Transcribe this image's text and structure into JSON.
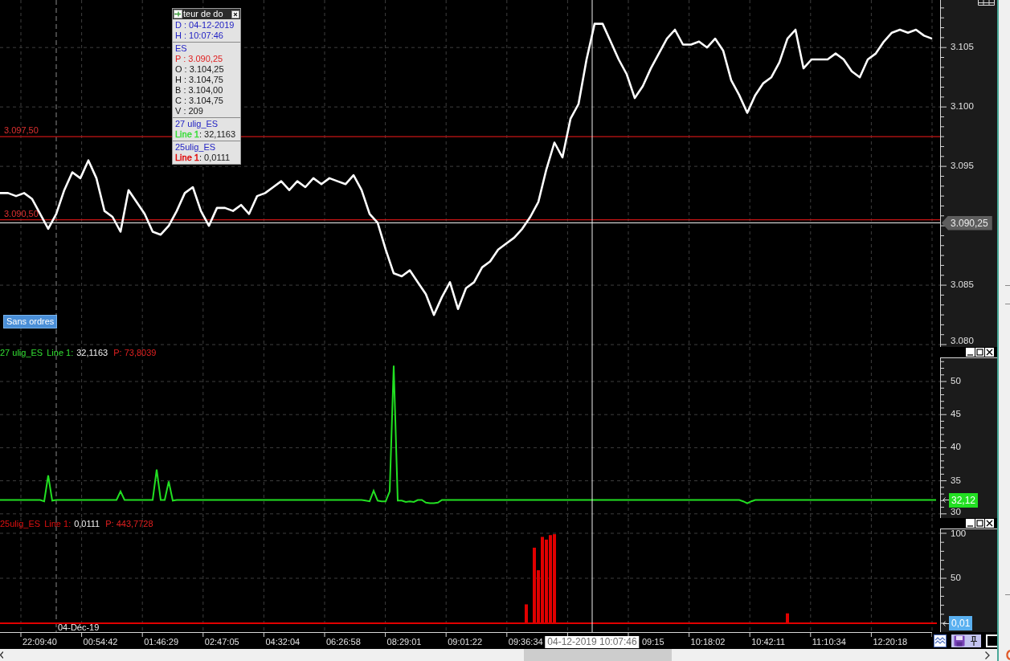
{
  "price_panel": {
    "order_button": {
      "label": "Sans ordres"
    },
    "chart_data": {
      "type": "line",
      "series": [
        {
          "color": "#ffffff",
          "values": [
            3092.75,
            3092.75,
            3092.5,
            3092.75,
            3092.25,
            3091,
            3089.75,
            3091,
            3093,
            3094.5,
            3094,
            3095.5,
            3094,
            3091.25,
            3090.75,
            3089.5,
            3093,
            3092,
            3091,
            3089.5,
            3089.25,
            3090,
            3091.25,
            3092.75,
            3093.25,
            3091.25,
            3090,
            3091.5,
            3091.5,
            3091.25,
            3091.75,
            3091,
            3092.5,
            3092.75,
            3093.25,
            3093.75,
            3093,
            3093.75,
            3093.25,
            3094,
            3093.5,
            3094,
            3093.75,
            3093.5,
            3094.25,
            3093,
            3091,
            3090.25,
            3088,
            3086,
            3085.75,
            3086.25,
            3085.25,
            3084.25,
            3082.5,
            3084,
            3085.25,
            3083,
            3084.75,
            3085.25,
            3086.5,
            3087,
            3088,
            3088.5,
            3089,
            3089.75,
            3090.75,
            3092,
            3094.75,
            3097,
            3095.75,
            3099,
            3100.25,
            3104,
            3107,
            3107,
            3105.5,
            3104,
            3102.75,
            3100.75,
            3101.75,
            3103.25,
            3104.5,
            3105.75,
            3106.5,
            3105.25,
            3105.25,
            3105.5,
            3105,
            3105.75,
            3104.75,
            3102.25,
            3101,
            3099.5,
            3101,
            3102,
            3102.5,
            3103.75,
            3105.75,
            3106.5,
            3103.25,
            3104,
            3104,
            3104,
            3104.5,
            3104,
            3103,
            3102.5,
            3104,
            3104.5,
            3105.5,
            3106.25,
            3106.5,
            3106.25,
            3106.5,
            3106,
            3105.75
          ]
        }
      ],
      "ylim": [
        3079.8,
        3109
      ],
      "yticks": [
        {
          "value": 3080,
          "label": "3.080"
        },
        {
          "value": 3085,
          "label": "3.085"
        },
        {
          "value": 3095,
          "label": "3.095"
        },
        {
          "value": 3100,
          "label": "3.100"
        },
        {
          "value": 3105,
          "label": "3.105"
        }
      ],
      "grid": true,
      "ref_lines": [
        {
          "axis": "y",
          "value": 3097.5,
          "label": "3.097,50"
        },
        {
          "axis": "y",
          "value": 3090.5,
          "label": "3.090,50"
        }
      ]
    }
  },
  "data_window": {
    "title": "teur de do",
    "sections": [
      {
        "lines": [
          {
            "kind": "heading",
            "text": "D : 04-12-2019"
          },
          {
            "kind": "heading",
            "text": "H : 10:07:46"
          }
        ]
      },
      {
        "lines": [
          {
            "kind": "heading",
            "text": "ES"
          },
          {
            "kind": "price",
            "text": "P : 3.090,25"
          },
          {
            "kind": "field",
            "text": "O : 3.104,25"
          },
          {
            "kind": "field",
            "text": "H : 3.104,75"
          },
          {
            "kind": "field",
            "text": "B : 3.104,00"
          },
          {
            "kind": "field",
            "text": "C : 3.104,75"
          },
          {
            "kind": "field",
            "text": "V : 209"
          }
        ]
      },
      {
        "lines": [
          {
            "kind": "heading",
            "text": "27 ulig_ES"
          },
          {
            "kind": "series",
            "label": "Line 1",
            "value": ": 32,1163",
            "color": "#33dd33"
          }
        ]
      },
      {
        "lines": [
          {
            "kind": "heading",
            "text": "25ulig_ES"
          },
          {
            "kind": "series",
            "label": "Line 1",
            "value": ": 0,0111",
            "color": "#e00000"
          }
        ]
      }
    ]
  },
  "indicators": [
    {
      "name": "27 ulig_ES",
      "color": "#33e033",
      "line_label": "Line 1:",
      "line_value": "32,1163",
      "p_value": "P: 73,8039",
      "value_tag": {
        "text": "32,12",
        "color": "#22e022"
      },
      "chart_data": {
        "type": "line",
        "series": [
          {
            "color": "#22e022",
            "values": [
              32.1,
              32.1,
              32.1,
              32.1,
              32.1,
              32.1,
              32.1,
              32.1,
              32.1,
              32.1,
              32.1,
              31.9,
              35.8,
              32.0,
              32.1,
              32.1,
              32.1,
              32.1,
              32.1,
              32.1,
              32.1,
              32.1,
              32.1,
              32.1,
              32.1,
              32.1,
              32.1,
              32.1,
              32.1,
              32.1,
              33.4,
              32.1,
              32.1,
              32.1,
              32.1,
              32.1,
              32.1,
              32.1,
              32.1,
              36.7,
              32.1,
              32.1,
              34.9,
              32.0,
              32.1,
              32.1,
              32.1,
              32.1,
              32.1,
              32.1,
              32.1,
              32.1,
              32.1,
              32.1,
              32.1,
              32.1,
              32.1,
              32.1,
              32.1,
              32.1,
              32.1,
              32.1,
              32.1,
              32.1,
              32.1,
              32.1,
              32.1,
              32.1,
              32.1,
              32.1,
              32.1,
              32.1,
              32.1,
              32.1,
              32.1,
              32.1,
              32.1,
              32.1,
              32.1,
              32.1,
              32.1,
              32.1,
              32.1,
              32.1,
              32.1,
              32.1,
              32.1,
              32.1,
              32.1,
              32.1,
              32.1,
              32.0,
              31.9,
              33.5,
              32.0,
              31.9,
              31.9,
              33.4,
              52.4,
              32.0,
              32.0,
              31.8,
              31.9,
              31.8,
              32.1,
              32.1,
              31.7,
              31.6,
              31.6,
              31.7,
              32.1,
              32.1,
              32.1,
              32.1,
              32.1,
              32.1,
              32.1,
              32.1,
              32.1,
              32.1,
              32.1,
              32.1,
              32.1,
              32.1,
              32.1,
              32.1,
              32.1,
              32.1,
              32.1,
              32.1,
              32.1,
              32.1,
              32.1,
              32.1,
              32.1,
              32.1,
              32.1,
              32.1,
              32.1,
              32.1,
              32.1,
              32.1,
              32.1,
              32.1,
              32.1,
              32.1,
              32.1,
              32.1,
              32.1,
              32.1,
              32.1,
              32.1,
              32.1,
              32.1,
              32.1,
              32.1,
              32.1,
              32.1,
              32.1,
              32.1,
              32.1,
              32.1,
              32.1,
              32.1,
              32.1,
              32.1,
              32.1,
              32.1,
              32.1,
              32.1,
              32.1,
              32.1,
              32.1,
              32.1,
              32.1,
              32.1,
              32.1,
              32.1,
              32.1,
              32.1,
              32.1,
              32.1,
              32.1,
              32.1,
              32.1,
              31.9,
              31.6,
              31.9,
              32.1,
              32.1,
              32.1,
              32.1,
              32.1,
              32.1,
              32.1,
              32.1,
              32.1,
              32.1,
              32.1,
              32.1,
              32.1,
              32.1,
              32.1,
              32.1,
              32.1,
              32.1,
              32.1,
              32.1,
              32.1,
              32.1,
              32.1,
              32.1,
              32.1,
              32.1,
              32.1,
              32.1,
              32.1,
              32.1,
              32.1,
              32.1,
              32.1,
              32.1,
              32.1,
              32.1,
              32.1,
              32.1,
              32.1,
              32.1,
              32.1,
              32.1,
              32.1,
              32.1,
              32.1,
              32.1
            ]
          }
        ],
        "ylim": [
          29.37,
          55.22
        ],
        "yticks": [
          {
            "value": 30,
            "label": "30"
          },
          {
            "value": 35,
            "label": "35"
          },
          {
            "value": 40,
            "label": "40"
          },
          {
            "value": 45,
            "label": "45"
          },
          {
            "value": 50,
            "label": "50"
          }
        ],
        "grid": true
      }
    },
    {
      "name": "25ulig_ES",
      "color": "#e01010",
      "line_label": "Line 1:",
      "line_value": "0,0111",
      "p_value": "P: 443,7728",
      "value_tag": {
        "text": "0,01",
        "color": "#5ab0f0"
      },
      "chart_data": {
        "type": "bar",
        "series": [
          {
            "color": "#e00000",
            "values": [
              0,
              0,
              0,
              0,
              0,
              0,
              0,
              0,
              0,
              0,
              0,
              0,
              0,
              0,
              0,
              0,
              0,
              0,
              0,
              0,
              0,
              0,
              0,
              0,
              0,
              0,
              0,
              0,
              0,
              0,
              0,
              0,
              0,
              0,
              0,
              0,
              0,
              0,
              0,
              0,
              0,
              0,
              0,
              0,
              0,
              0,
              0,
              0,
              0,
              0,
              0,
              0,
              0,
              0,
              0,
              0,
              0,
              0,
              0,
              0,
              0,
              0,
              0,
              0,
              0,
              0,
              0,
              0,
              0,
              0,
              0,
              0,
              0,
              0,
              0,
              0,
              0,
              0,
              0,
              0,
              0,
              0,
              0,
              0,
              0,
              0,
              0,
              0,
              0,
              0,
              0,
              0,
              0,
              0,
              0,
              0,
              0,
              0,
              0,
              0,
              0,
              0,
              0,
              0,
              0,
              0,
              0,
              0,
              0,
              0,
              0,
              0,
              0,
              0,
              0,
              0,
              0,
              0,
              0,
              0,
              0,
              0,
              0,
              0,
              0,
              0,
              0,
              0,
              0,
              0,
              0,
              21,
              0,
              84,
              59,
              96,
              93,
              98,
              99,
              0,
              0,
              0,
              0,
              0,
              0,
              0,
              0,
              0,
              0,
              0,
              0,
              0,
              0,
              0,
              0,
              0,
              0,
              0,
              0,
              0,
              0,
              0,
              0,
              0,
              0,
              0,
              0,
              0,
              0,
              0,
              0,
              0,
              0,
              0,
              0,
              0,
              0,
              0,
              0,
              0,
              0,
              0,
              0,
              0,
              0,
              0,
              0,
              0,
              0,
              0,
              0,
              0,
              0,
              0,
              0,
              0,
              11,
              0,
              0,
              0,
              0,
              0,
              0,
              0,
              0,
              0,
              0,
              0,
              0,
              0,
              0,
              0,
              0,
              0,
              0,
              0,
              0,
              0,
              0,
              0,
              0,
              0,
              0,
              0,
              0,
              0,
              0,
              0,
              0,
              0,
              0,
              0,
              0,
              0
            ]
          }
        ],
        "ylim": [
          -9.82,
          116.96
        ],
        "yticks": [
          {
            "value": 50,
            "label": "50"
          },
          {
            "value": 100,
            "label": "100"
          }
        ],
        "grid": true,
        "ref_lines": [
          {
            "axis": "y",
            "value": 0
          }
        ]
      }
    }
  ],
  "crosshair": {
    "time_label": "04-12-2019 10:07:46",
    "price_label": "3.090,25"
  },
  "day_separator": {
    "label": "04-Déc-19"
  },
  "time_axis": {
    "labels": [
      "22:09:40",
      "00:54:42",
      "01:46:29",
      "02:47:05",
      "04:32:04",
      "06:26:58",
      "08:29:01",
      "09:01:22",
      "09:36:34",
      "09:15",
      "10:18:02",
      "10:42:11",
      "11:10:34",
      "12:20:18"
    ]
  }
}
